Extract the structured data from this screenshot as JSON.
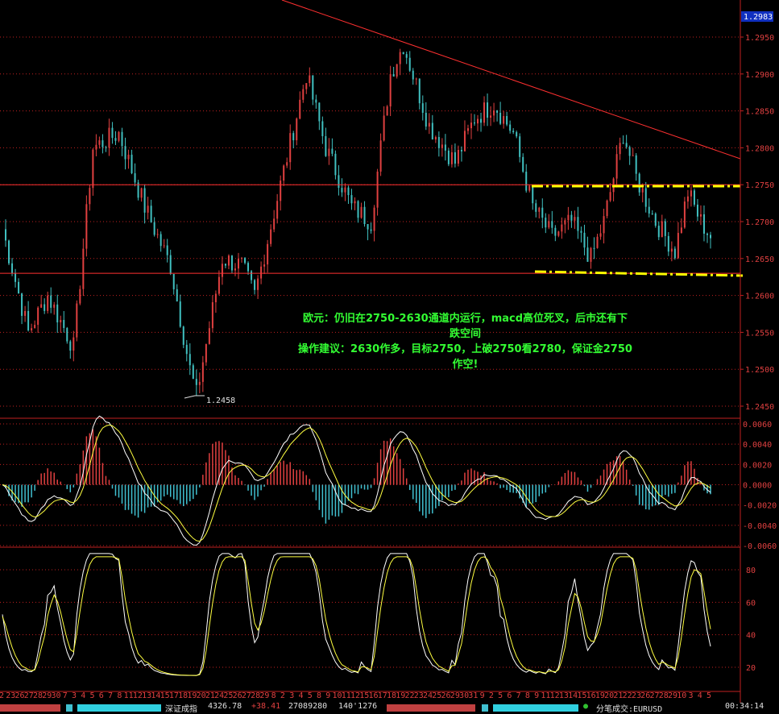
{
  "price_badge": "1.2983",
  "price_axis": [
    "1.2950",
    "1.2900",
    "1.2850",
    "1.2800",
    "1.2750",
    "1.2700",
    "1.2650",
    "1.2600",
    "1.2550",
    "1.2500",
    "1.2450"
  ],
  "macd_axis": [
    "0.0060",
    "0.0040",
    "0.0020",
    "0.0000",
    "-0.0020",
    "-0.0040",
    "-0.0060"
  ],
  "kd_axis": [
    "80",
    "60",
    "40",
    "20"
  ],
  "low_label": "1.2458",
  "annotation": {
    "line1": "欧元：仍旧在2750-2630通道内运行，macd高位死叉，后市还有下",
    "line2": "跌空间",
    "line3": "操作建议：2630作多，目标2750，上破2750看2780，保证金2750",
    "line4": "作空!"
  },
  "date_labels": [
    "2",
    "23",
    "26",
    "27",
    "28",
    "29",
    "30",
    "7",
    "3",
    "4",
    "5",
    "6",
    "7",
    "8",
    "11",
    "12",
    "13",
    "14",
    "15",
    "17",
    "18",
    "19",
    "20",
    "21",
    "24",
    "25",
    "26",
    "27",
    "28",
    "29",
    "8",
    "2",
    "3",
    "4",
    "5",
    "8",
    "9",
    "10",
    "11",
    "12",
    "15",
    "16",
    "17",
    "18",
    "19",
    "22",
    "23",
    "24",
    "25",
    "26",
    "29",
    "30",
    "31",
    "9",
    "2",
    "5",
    "6",
    "7",
    "8",
    "9",
    "11",
    "12",
    "13",
    "14",
    "15",
    "16",
    "19",
    "20",
    "21",
    "22",
    "23",
    "26",
    "27",
    "28",
    "29",
    "10",
    "3",
    "4",
    "5"
  ],
  "status_bar": {
    "index_name": "深证成指",
    "index_value": "4326.78",
    "index_change": "+38.41",
    "volume": "27089280",
    "amount": "140'1276",
    "right_label": "分笔成交:EURUSD",
    "clock": "00:34:14"
  },
  "colors": {
    "up": "#e04040",
    "down": "#40c0c0",
    "gridline": "#c02020",
    "trend": "#ff3030",
    "channel": "#ffff00",
    "text_green": "#33ff33",
    "macd_line1": "#ffffff",
    "macd_line2": "#ffff40",
    "bar_up": "#e04040",
    "bar_down": "#40c0d0"
  },
  "chart_data": {
    "type": "candlestick",
    "symbol": "EURUSD",
    "price_range": [
      1.245,
      1.2983
    ],
    "low_marker": 1.2458,
    "channel_top": 1.275,
    "channel_bottom": 1.263,
    "h_lines": [
      1.275,
      1.263
    ],
    "macd_range": [
      -0.006,
      0.006
    ],
    "kd_range": [
      10,
      90
    ]
  }
}
